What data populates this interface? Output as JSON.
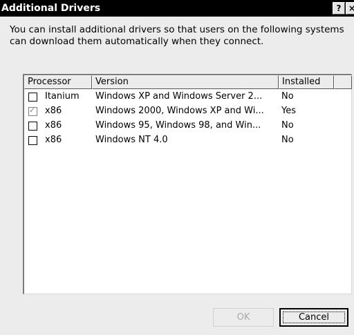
{
  "window": {
    "title": "Additional Drivers",
    "help_glyph": "?",
    "close_glyph": "×"
  },
  "description": "You can install additional drivers so that users on the following systems can download them automatically when they connect.",
  "table": {
    "columns": [
      "Processor",
      "Version",
      "Installed"
    ],
    "rows": [
      {
        "checked": false,
        "processor": "Itanium",
        "version": "Windows XP and Windows Server 2...",
        "installed": "No"
      },
      {
        "checked": true,
        "processor": "x86",
        "version": "Windows 2000, Windows XP and Wi...",
        "installed": "Yes"
      },
      {
        "checked": false,
        "processor": "x86",
        "version": "Windows 95, Windows 98, and Win...",
        "installed": "No"
      },
      {
        "checked": false,
        "processor": "x86",
        "version": "Windows NT 4.0",
        "installed": "No"
      }
    ]
  },
  "buttons": {
    "ok": "OK",
    "cancel": "Cancel"
  },
  "colors": {
    "titlebar": "#000000",
    "dialog_bg": "#ececec",
    "list_bg": "#ffffff",
    "disabled_text": "#a8a8a8"
  }
}
